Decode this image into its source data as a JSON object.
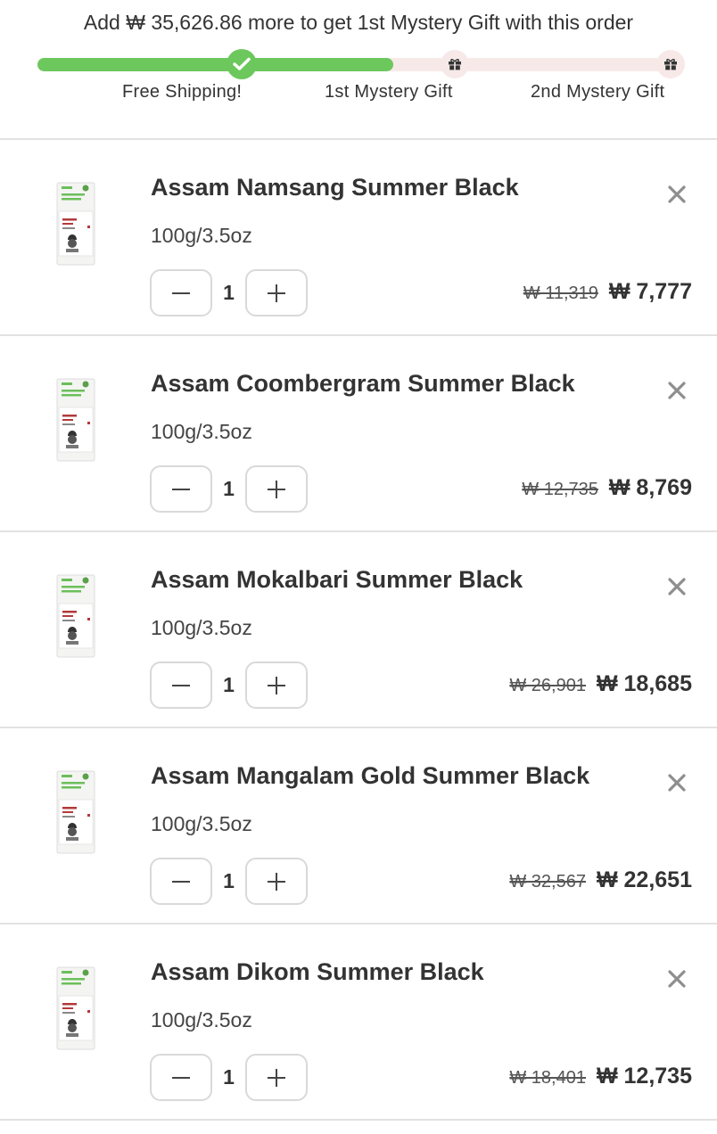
{
  "promo": {
    "message": "Add ₩ 35,626.86 more to get 1st Mystery Gift with this order",
    "progress_fraction": 0.55,
    "milestones": [
      {
        "label": "Free Shipping!",
        "icon": "check-icon",
        "reached": true
      },
      {
        "label": "1st Mystery Gift",
        "icon": "gift-icon",
        "reached": false
      },
      {
        "label": "2nd Mystery Gift",
        "icon": "gift-icon",
        "reached": false
      }
    ],
    "colors": {
      "fill": "#6cc85d",
      "track": "#f8e9e9"
    }
  },
  "items": [
    {
      "title": "Assam Namsang Summer Black",
      "variant": "100g/3.5oz",
      "quantity": "1",
      "old_price": "₩ 11,319",
      "price": "₩ 7,777"
    },
    {
      "title": "Assam Coombergram Summer Black",
      "variant": "100g/3.5oz",
      "quantity": "1",
      "old_price": "₩ 12,735",
      "price": "₩ 8,769"
    },
    {
      "title": "Assam Mokalbari Summer Black",
      "variant": "100g/3.5oz",
      "quantity": "1",
      "old_price": "₩ 26,901",
      "price": "₩ 18,685"
    },
    {
      "title": "Assam Mangalam Gold Summer Black",
      "variant": "100g/3.5oz",
      "quantity": "1",
      "old_price": "₩ 32,567",
      "price": "₩ 22,651"
    },
    {
      "title": "Assam Dikom Summer Black",
      "variant": "100g/3.5oz",
      "quantity": "1",
      "old_price": "₩ 18,401",
      "price": "₩ 12,735"
    }
  ]
}
